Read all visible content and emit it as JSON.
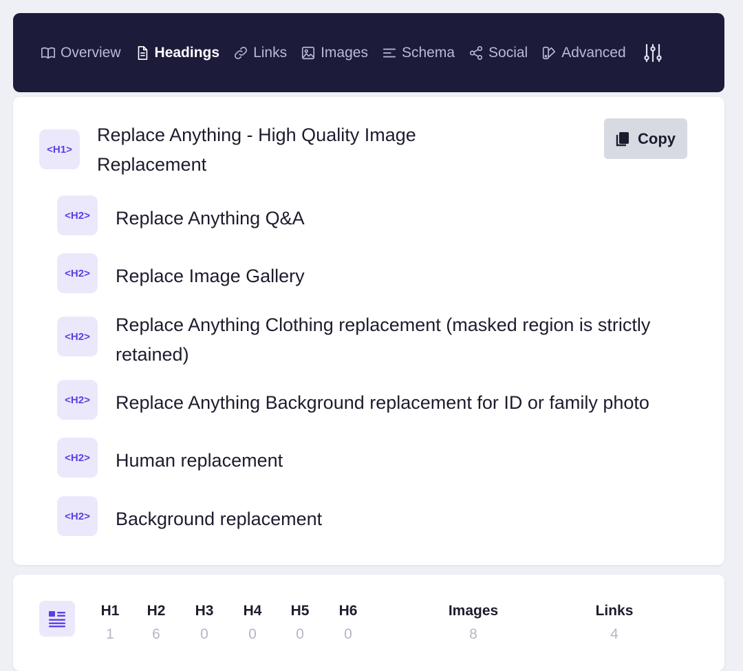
{
  "nav": {
    "items": [
      {
        "label": "Overview",
        "icon": "book-open-icon",
        "active": false
      },
      {
        "label": "Headings",
        "icon": "document-icon",
        "active": true
      },
      {
        "label": "Links",
        "icon": "link-icon",
        "active": false
      },
      {
        "label": "Images",
        "icon": "image-icon",
        "active": false
      },
      {
        "label": "Schema",
        "icon": "lines-icon",
        "active": false
      },
      {
        "label": "Social",
        "icon": "share-icon",
        "active": false
      },
      {
        "label": "Advanced",
        "icon": "swatch-icon",
        "active": false
      }
    ],
    "settings_icon": "sliders-icon"
  },
  "headings": {
    "copy_label": "Copy",
    "items": [
      {
        "tag": "<H1>",
        "text": "Replace Anything - High Quality Image Replacement"
      },
      {
        "tag": "<H2>",
        "text": "Replace Anything Q&A"
      },
      {
        "tag": "<H2>",
        "text": "Replace Image Gallery"
      },
      {
        "tag": "<H2>",
        "text": "Replace Anything Clothing replacement (masked region is strictly retained)"
      },
      {
        "tag": "<H2>",
        "text": "Replace Anything Background replacement for ID or family photo"
      },
      {
        "tag": "<H2>",
        "text": "Human replacement"
      },
      {
        "tag": "<H2>",
        "text": "Background replacement"
      }
    ]
  },
  "stats": {
    "items": [
      {
        "label": "H1",
        "value": "1"
      },
      {
        "label": "H2",
        "value": "6"
      },
      {
        "label": "H3",
        "value": "0"
      },
      {
        "label": "H4",
        "value": "0"
      },
      {
        "label": "H5",
        "value": "0"
      },
      {
        "label": "H6",
        "value": "0"
      },
      {
        "label": "Images",
        "value": "8"
      },
      {
        "label": "Links",
        "value": "4"
      }
    ]
  },
  "colors": {
    "nav_bg": "#1c1b3a",
    "tag_bg": "#ebe8fc",
    "tag_text": "#5b3fe0",
    "copy_bg": "#d7dae1"
  }
}
